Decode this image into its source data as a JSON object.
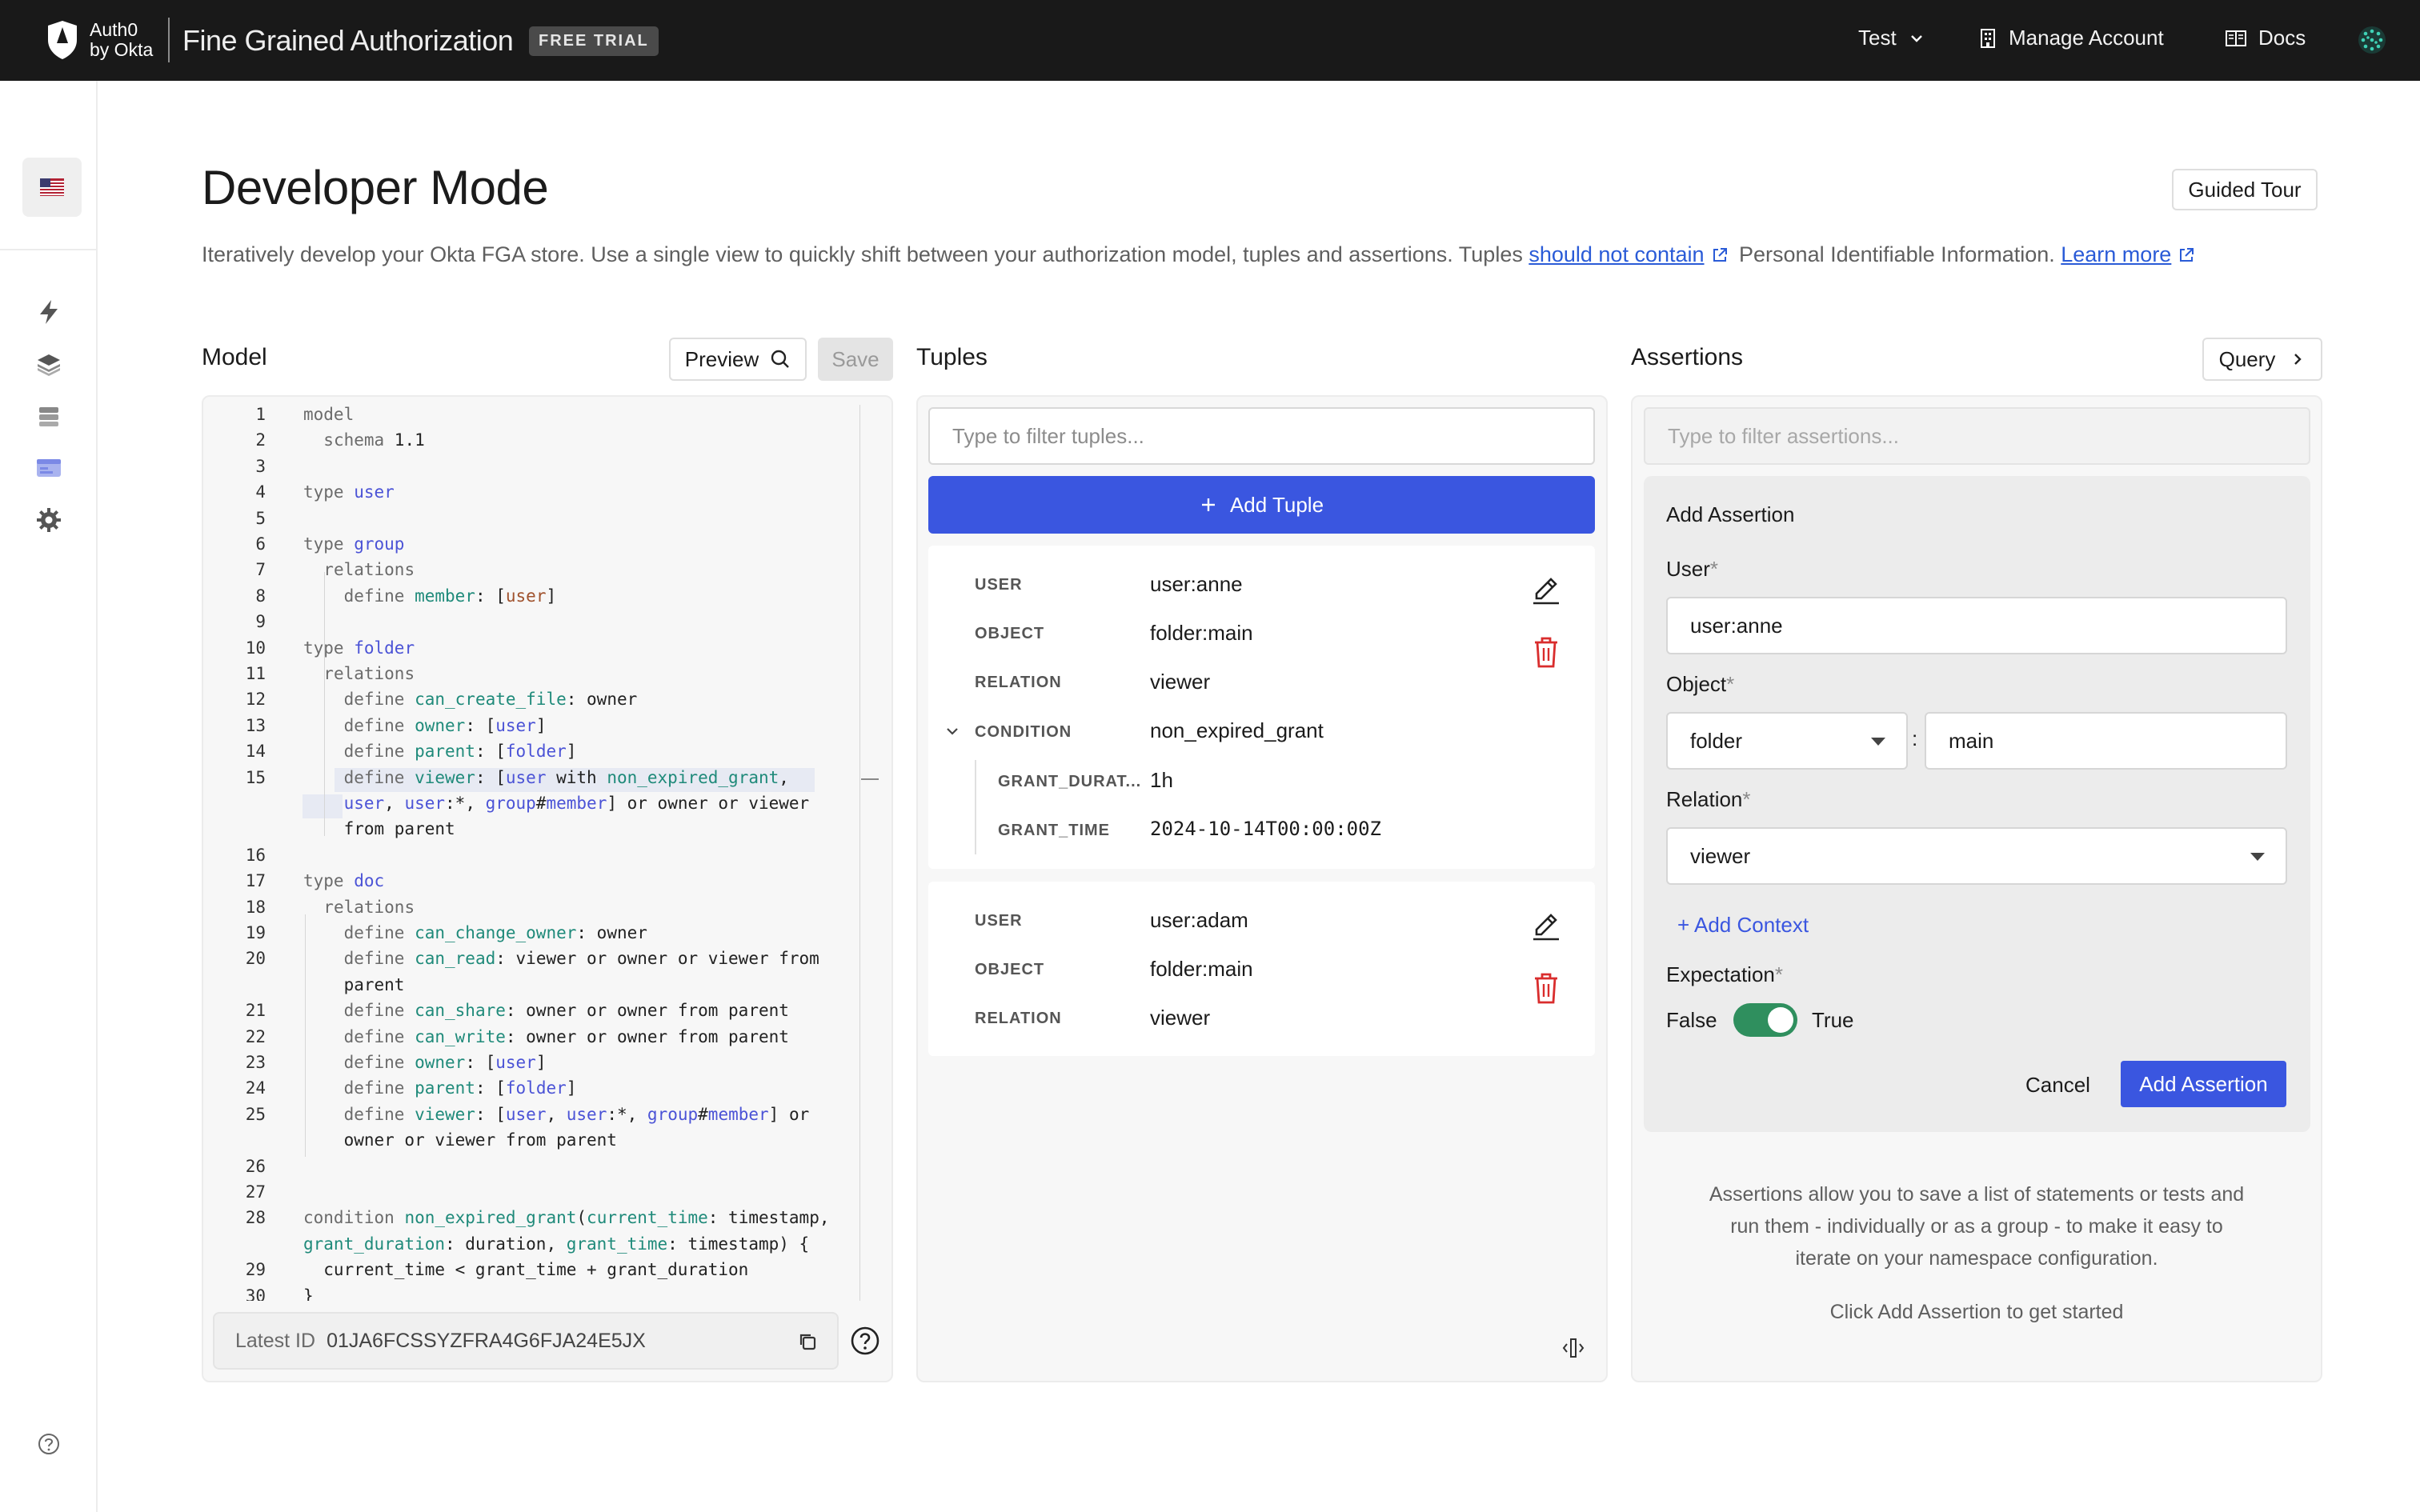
{
  "header": {
    "logo_text_1": "Auth0",
    "logo_text_2": "by Okta",
    "app_name": "Fine Grained Authorization",
    "trial_badge": "FREE TRIAL",
    "tenant": "Test",
    "manage_account": "Manage Account",
    "docs": "Docs"
  },
  "page": {
    "title": "Developer Mode",
    "desc_pre": "Iteratively develop your Okta FGA store. Use a single view to quickly shift between your authorization model, tuples and assertions. Tuples ",
    "desc_link1": "should not contain",
    "desc_mid": " Personal Identifiable Information. ",
    "desc_link2": "Learn more",
    "guided_tour": "Guided Tour"
  },
  "model": {
    "title": "Model",
    "preview_label": "Preview",
    "save_label": "Save",
    "latest_id_label": "Latest ID",
    "latest_id": "01JA6FCSSYZFRA4G6FJA24E5JX",
    "lines": [
      {
        "n": "1",
        "html": "<span class='kw'>model</span>"
      },
      {
        "n": "2",
        "html": "  <span class='kw'>schema</span> 1.1"
      },
      {
        "n": "3",
        "html": ""
      },
      {
        "n": "4",
        "html": "<span class='kw'>type</span> <span class='ty'>user</span>"
      },
      {
        "n": "5",
        "html": ""
      },
      {
        "n": "6",
        "html": "<span class='kw'>type</span> <span class='ty'>group</span>"
      },
      {
        "n": "7",
        "html": "  <span class='kw'>relations</span>"
      },
      {
        "n": "8",
        "html": "    <span class='kw'>define</span> <span class='fn'>member</span>: [<span style='color:#a0522d'>user</span>]"
      },
      {
        "n": "9",
        "html": ""
      },
      {
        "n": "10",
        "html": "<span class='kw'>type</span> <span class='ty'>folder</span>"
      },
      {
        "n": "11",
        "html": "  <span class='kw'>relations</span>"
      },
      {
        "n": "12",
        "html": "    <span class='kw'>define</span> <span class='fn'>can_create_file</span>: owner"
      },
      {
        "n": "13",
        "html": "    <span class='kw'>define</span> <span class='fn'>owner</span>: [<span class='ty'>user</span>]"
      },
      {
        "n": "14",
        "html": "    <span class='kw'>define</span> <span class='fn'>parent</span>: [<span class='ty'>folder</span>]"
      },
      {
        "n": "15",
        "html": "    <span class='kw'>define</span> <span class='fn'>viewer</span>: [<span class='ty'>user</span> with <span class='fn'>non_expired_grant</span>,"
      },
      {
        "n": "",
        "html": "    <span class='ty'>user</span>, <span class='ty'>user</span>:*, <span class='ty'>group</span>#<span class='ty'>member</span>] or owner or viewer"
      },
      {
        "n": "",
        "html": "    from parent"
      },
      {
        "n": "16",
        "html": ""
      },
      {
        "n": "17",
        "html": "<span class='kw'>type</span> <span class='ty'>doc</span>"
      },
      {
        "n": "18",
        "html": "  <span class='kw'>relations</span>"
      },
      {
        "n": "19",
        "html": "    <span class='kw'>define</span> <span class='fn'>can_change_owner</span>: owner"
      },
      {
        "n": "20",
        "html": "    <span class='kw'>define</span> <span class='fn'>can_read</span>: viewer or owner or viewer from"
      },
      {
        "n": "",
        "html": "    parent"
      },
      {
        "n": "21",
        "html": "    <span class='kw'>define</span> <span class='fn'>can_share</span>: owner or owner from parent"
      },
      {
        "n": "22",
        "html": "    <span class='kw'>define</span> <span class='fn'>can_write</span>: owner or owner from parent"
      },
      {
        "n": "23",
        "html": "    <span class='kw'>define</span> <span class='fn'>owner</span>: [<span class='ty'>user</span>]"
      },
      {
        "n": "24",
        "html": "    <span class='kw'>define</span> <span class='fn'>parent</span>: [<span class='ty'>folder</span>]"
      },
      {
        "n": "25",
        "html": "    <span class='kw'>define</span> <span class='fn'>viewer</span>: [<span class='ty'>user</span>, <span class='ty'>user</span>:*, <span class='ty'>group</span>#<span class='ty'>member</span>] or"
      },
      {
        "n": "",
        "html": "    owner or viewer from parent"
      },
      {
        "n": "26",
        "html": ""
      },
      {
        "n": "27",
        "html": ""
      },
      {
        "n": "28",
        "html": "<span class='kw'>condition</span> <span class='fn'>non_expired_grant</span>(<span class='fn'>current_time</span>: timestamp,"
      },
      {
        "n": "",
        "html": "<span class='fn'>grant_duration</span>: duration, <span class='fn'>grant_time</span>: timestamp) {"
      },
      {
        "n": "29",
        "html": "  current_time &lt; grant_time + grant_duration"
      },
      {
        "n": "30",
        "html": "}"
      }
    ]
  },
  "tuples": {
    "title": "Tuples",
    "filter_placeholder": "Type to filter tuples...",
    "add_label": "Add Tuple",
    "items": [
      {
        "user_key": "USER",
        "user": "user:anne",
        "object_key": "OBJECT",
        "object": "folder:main",
        "relation_key": "RELATION",
        "relation": "viewer",
        "condition_key": "CONDITION",
        "condition": "non_expired_grant",
        "p1_key": "GRANT_DURAT...",
        "p1": "1h",
        "p2_key": "GRANT_TIME",
        "p2": "2024-10-14T00:00:00Z"
      },
      {
        "user_key": "USER",
        "user": "user:adam",
        "object_key": "OBJECT",
        "object": "folder:main",
        "relation_key": "RELATION",
        "relation": "viewer"
      }
    ]
  },
  "assertions": {
    "title": "Assertions",
    "query_label": "Query",
    "filter_placeholder": "Type to filter assertions...",
    "form_title": "Add Assertion",
    "user_label": "User",
    "user_value": "user:anne",
    "object_label": "Object",
    "object_type": "folder",
    "object_sep": ":",
    "object_id": "main",
    "relation_label": "Relation",
    "relation_value": "viewer",
    "add_context": "+ Add Context",
    "expectation_label": "Expectation",
    "false_label": "False",
    "true_label": "True",
    "expectation_value": true,
    "cancel_label": "Cancel",
    "submit_label": "Add Assertion",
    "required_mark": "*",
    "info_1": "Assertions allow you to save a list of statements or tests and",
    "info_2": "run them - individually or as a group - to make it easy to",
    "info_3": "iterate on your namespace configuration.",
    "info_4": "Click Add Assertion to get started"
  },
  "colors": {
    "accent": "#3a56e0",
    "toggle_on": "#2f8f5e",
    "delete": "#d92d2d",
    "topbar": "#191919"
  }
}
